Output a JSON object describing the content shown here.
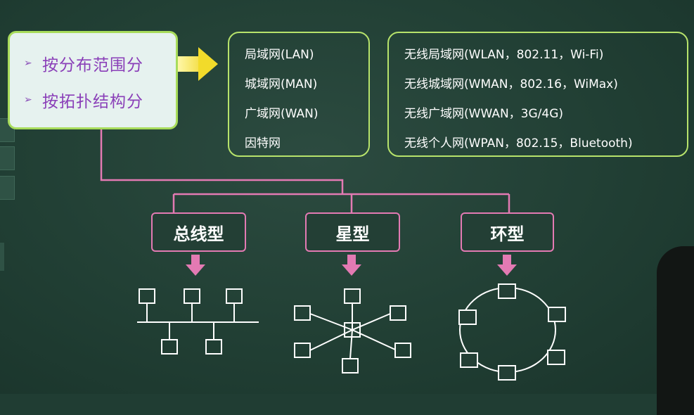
{
  "classification": {
    "items": [
      {
        "bullet": "➢",
        "label": "按分布范围分"
      },
      {
        "bullet": "➢",
        "label": "按拓扑结构分"
      }
    ]
  },
  "scope_networks": [
    "局域网(LAN)",
    "城域网(MAN)",
    "广域网(WAN)",
    "因特网"
  ],
  "wireless_networks": [
    "无线局域网(WLAN，802.11，Wi-Fi)",
    "无线城域网(WMAN，802.16，WiMax)",
    "无线广域网(WWAN，3G/4G)",
    "无线个人网(WPAN，802.15，Bluetooth)"
  ],
  "topologies": {
    "bus": "总线型",
    "star": "星型",
    "ring": "环型"
  },
  "colors": {
    "board": "#213f34",
    "box_border_green": "#b7e36b",
    "classify_text": "#8a3fb8",
    "topology_border": "#e37ab3",
    "arrow_yellow": "#f2db2a"
  }
}
